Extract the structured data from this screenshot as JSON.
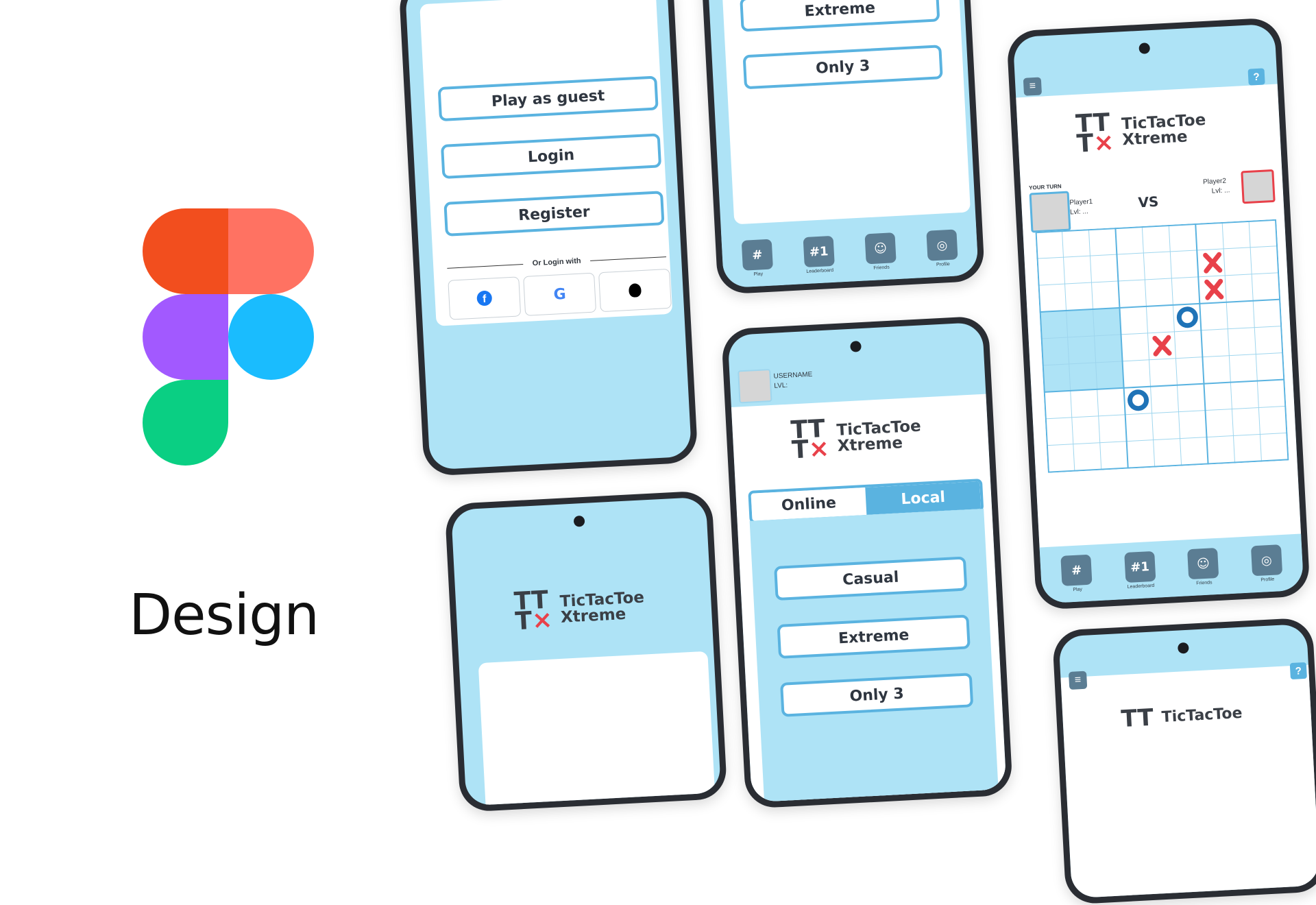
{
  "design_label": "Design",
  "app": {
    "brand_line1": "TicTacToe",
    "brand_line2": "Xtreme",
    "mark_top": "TT",
    "mark_bottom_t": "T",
    "mark_bottom_x": "×"
  },
  "login_screen": {
    "guest_label": "Play as guest",
    "login_label": "Login",
    "register_label": "Register",
    "or_login_with": "Or Login with"
  },
  "mode_screen_top": {
    "extreme_label": "Extreme",
    "only3_label": "Only 3"
  },
  "mode_screen": {
    "username": "USERNAME",
    "level": "LVL:",
    "tabs": [
      "Online",
      "Local"
    ],
    "casual_label": "Casual",
    "extreme_label": "Extreme",
    "only3_label": "Only 3"
  },
  "game_screen": {
    "your_turn": "YOUR TURN",
    "player1": "Player1",
    "player1_lvl": "Lvl: ...",
    "vs": "VS",
    "player2": "Player2",
    "player2_lvl": "Lvl: ..."
  },
  "nav": {
    "play": "Play",
    "leaderboard": "Leaderboard",
    "friends": "Friends",
    "profile": "Profile",
    "leaderboard_glyph": "#1"
  },
  "colors": {
    "screen_bg": "#aee3f6",
    "accent": "#5ab3e0",
    "x_mark": "#e8414a",
    "o_mark": "#1f73b7",
    "figma_red": "#f24e1e",
    "figma_salmon": "#ff7262",
    "figma_purple": "#a259ff",
    "figma_blue": "#1abcfe",
    "figma_green": "#0acf83"
  }
}
